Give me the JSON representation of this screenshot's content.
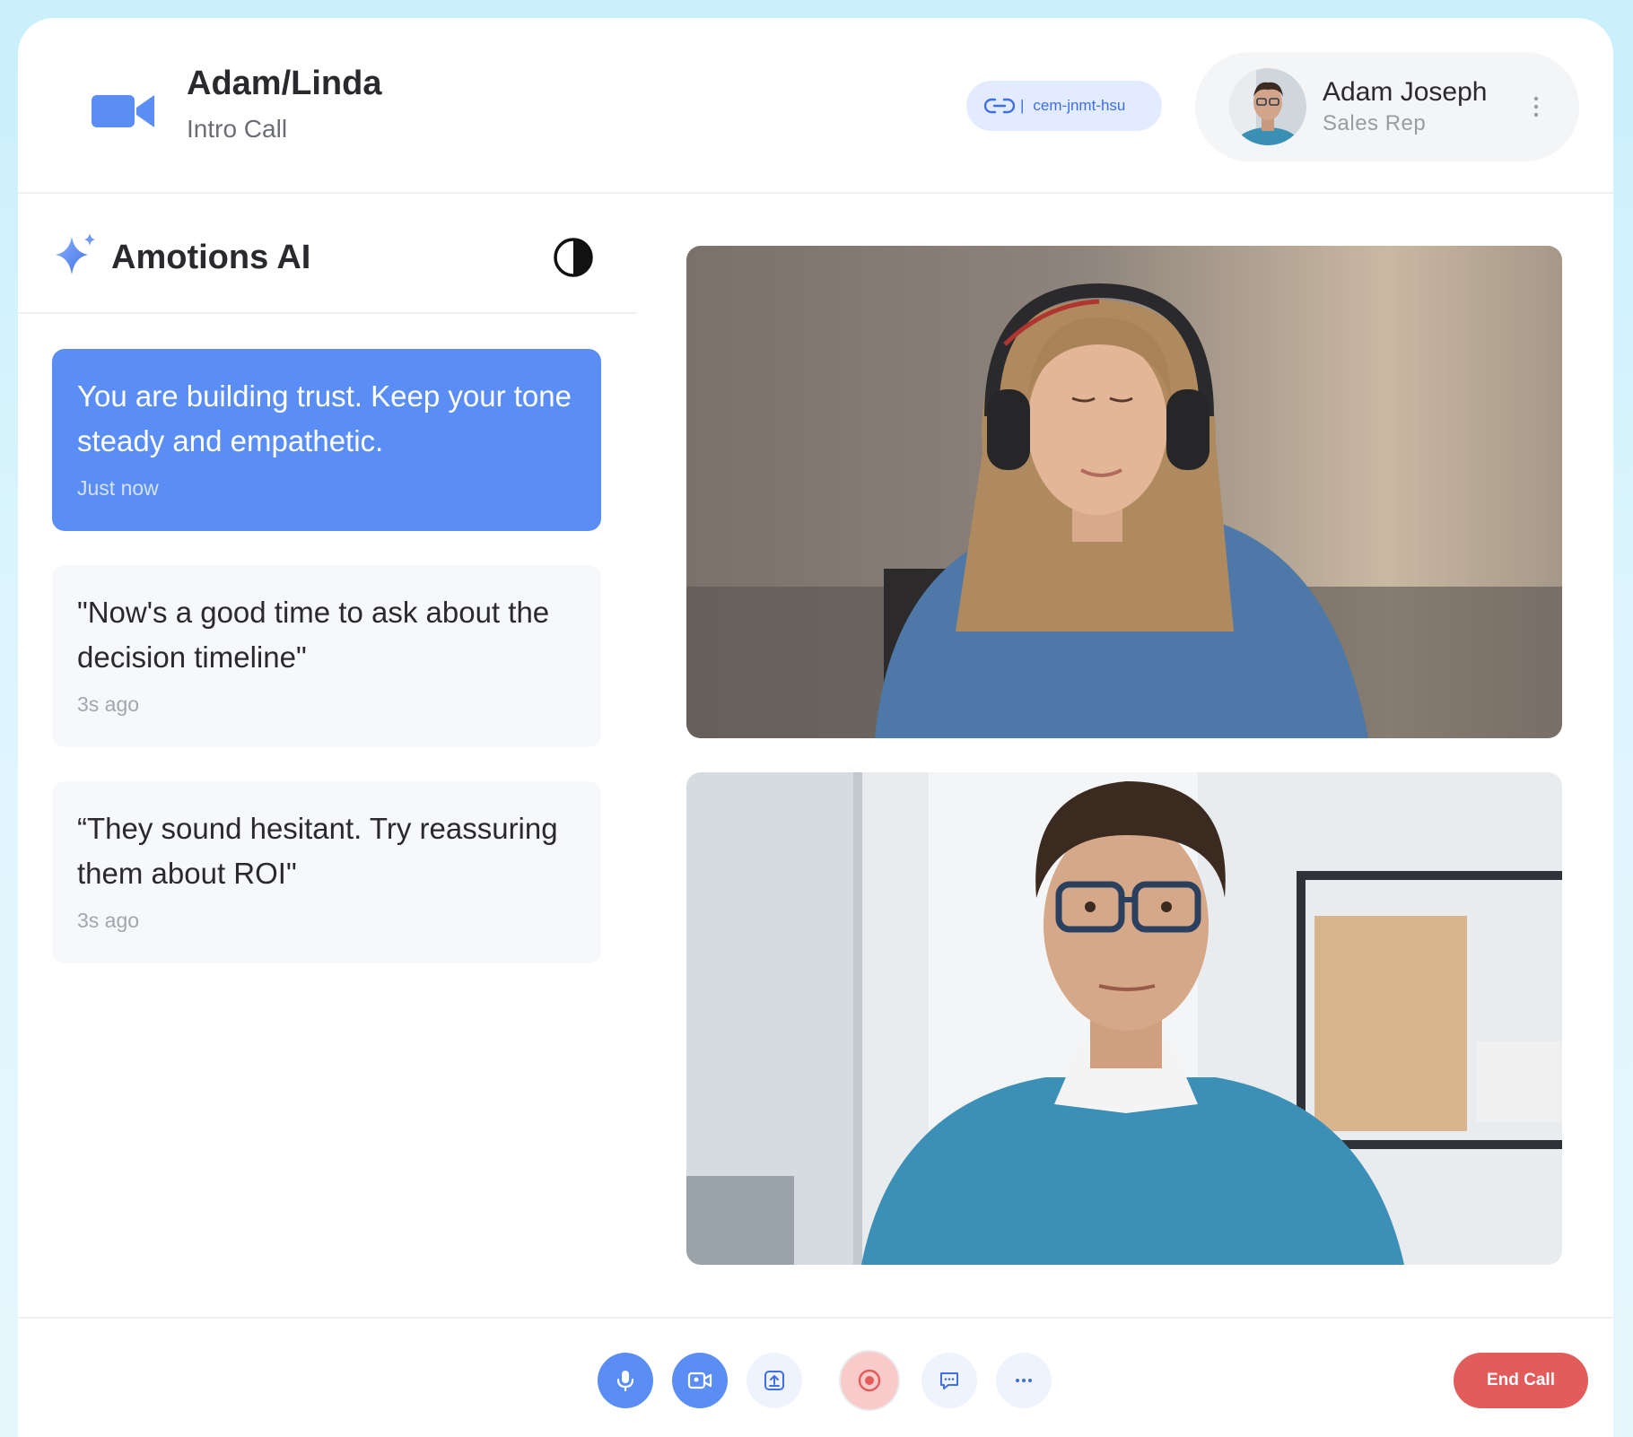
{
  "colors": {
    "accent": "#5b8ef5",
    "danger": "#e25c5c",
    "link": "#3e6fe6"
  },
  "header": {
    "logo_icon": "video-camera-icon",
    "title": "Adam/Linda",
    "subtitle": "Intro Call",
    "meeting_code": "cem-jnmt-hsu",
    "link_icon": "link-icon",
    "user": {
      "name": "Adam Joseph",
      "role": "Sales Rep",
      "menu_icon": "kebab-menu-icon"
    }
  },
  "ai_panel": {
    "icon": "sparkle-icon",
    "title": "Amotions AI",
    "theme_icon": "contrast-icon",
    "suggestions": [
      {
        "text": "You are building trust. Keep your tone steady and empathetic.",
        "time": "Just now",
        "active": true
      },
      {
        "text": "\"Now's a good time to ask about the decision timeline\"",
        "time": "3s ago",
        "active": false
      },
      {
        "text": "“They sound hesitant. Try reassuring them about ROI\"",
        "time": "3s ago",
        "active": false
      }
    ]
  },
  "videos": [
    {
      "participant": "woman-with-headphones"
    },
    {
      "participant": "man-with-glasses"
    }
  ],
  "controls": {
    "buttons": [
      "microphone-icon",
      "camera-icon",
      "share-screen-icon",
      "record-icon",
      "chat-icon",
      "more-icon"
    ],
    "end_call_label": "End Call"
  }
}
